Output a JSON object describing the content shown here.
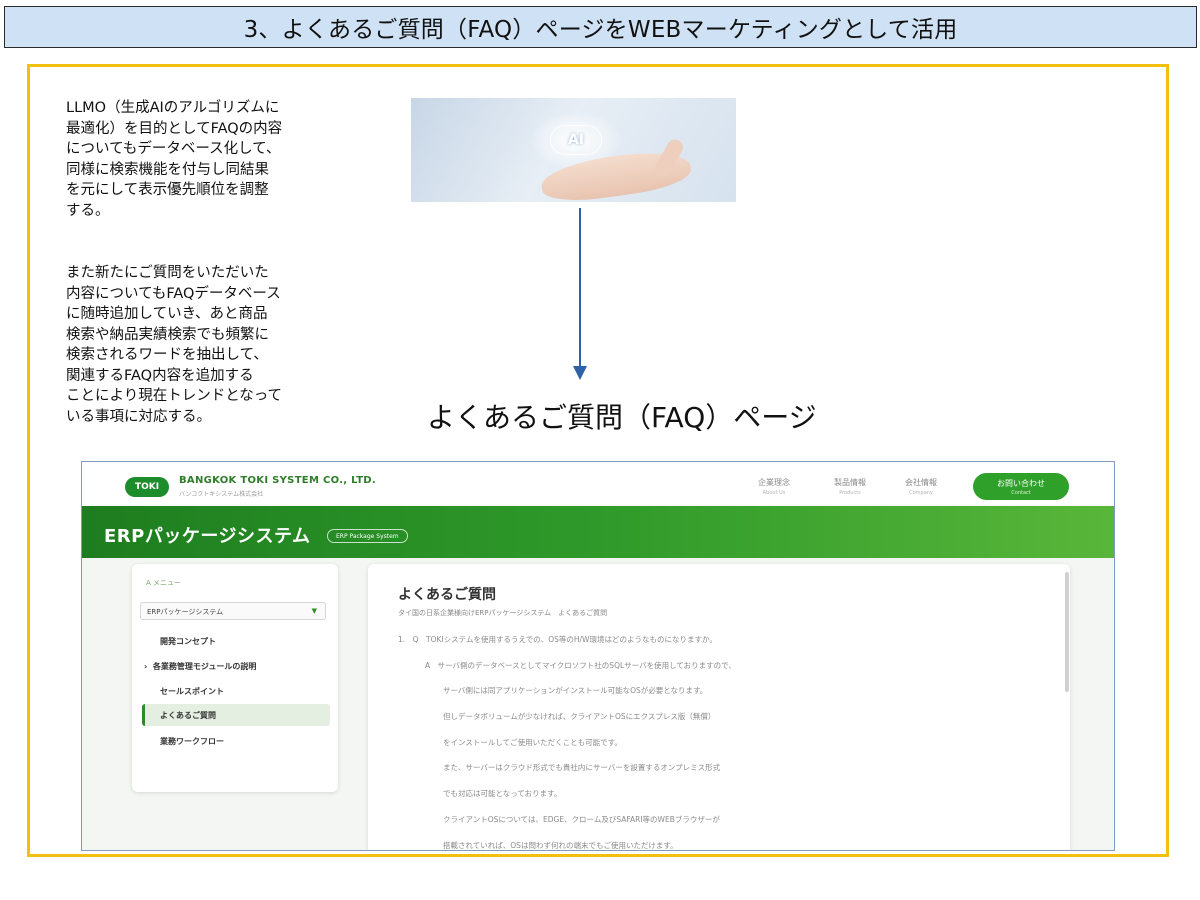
{
  "header": {
    "title": "3、よくあるご質問（FAQ）ページをWEBマーケティングとして活用"
  },
  "description": {
    "paragraph1": "LLMO（生成AIのアルゴリズムに\n最適化）を目的としてFAQの内容\nについてもデータベース化して、\n同様に検索機能を付与し同結果\nを元にして表示優先順位を調整\nする。",
    "paragraph2": "また新たにご質問をいただいた\n内容についてもFAQデータベース\nに随時追加していき、あと商品\n検索や納品実績検索でも頻繁に\n検索されるワードを抽出して、\n関連するFAQ内容を追加する\nことにより現在トレンドとなって\nいる事項に対応する。"
  },
  "image": {
    "badge": "AI"
  },
  "caption": "よくあるご質問（FAQ）ページ",
  "site": {
    "logo": "TOKI",
    "company_name": "BANGKOK TOKI SYSTEM CO., LTD.",
    "company_sub": "バンコクトキシステム株式会社",
    "nav": [
      {
        "label": "企業理念",
        "sub": "About Us"
      },
      {
        "label": "製品情報",
        "sub": "Products"
      },
      {
        "label": "会社情報",
        "sub": "Company"
      }
    ],
    "contact": {
      "label": "お問い合わせ",
      "sub": "Contact"
    },
    "band_title": "ERPパッケージシステム",
    "band_pill": "ERP Package System",
    "menu": {
      "heading": "A メニュー",
      "select": "ERPパッケージシステム",
      "items": [
        "開発コンセプト",
        "各業務管理モジュールの説明",
        "セールスポイント",
        "よくあるご質問",
        "業務ワークフロー"
      ]
    },
    "faq": {
      "title": "よくあるご質問",
      "subtitle": "タイ国の日系企業様向けERPパッケージシステム　よくあるご質問",
      "lines": [
        "1.　Q　TOKIシステムを使用するうえでの、OS等のH/W環境はどのようなものになりますか。",
        "A　サーバ側のデータベースとしてマイクロソフト社のSQLサーバを使用しておりますので、",
        "サーバ側には同アプリケーションがインストール可能なOSが必要となります。",
        "但しデータボリュームが少なければ、クライアントOSにエクスプレス版（無償）",
        "をインストールしてご使用いただくことも可能です。",
        "また、サーバーはクラウド形式でも貴社内にサーバーを設置するオンプレミス形式",
        "でも対応は可能となっております。",
        "クライアントOSについては、EDGE、クローム及びSAFARI等のWEBブラウザーが",
        "搭載されていれば、OSは問わず何れの端末でもご使用いただけます。"
      ]
    }
  }
}
